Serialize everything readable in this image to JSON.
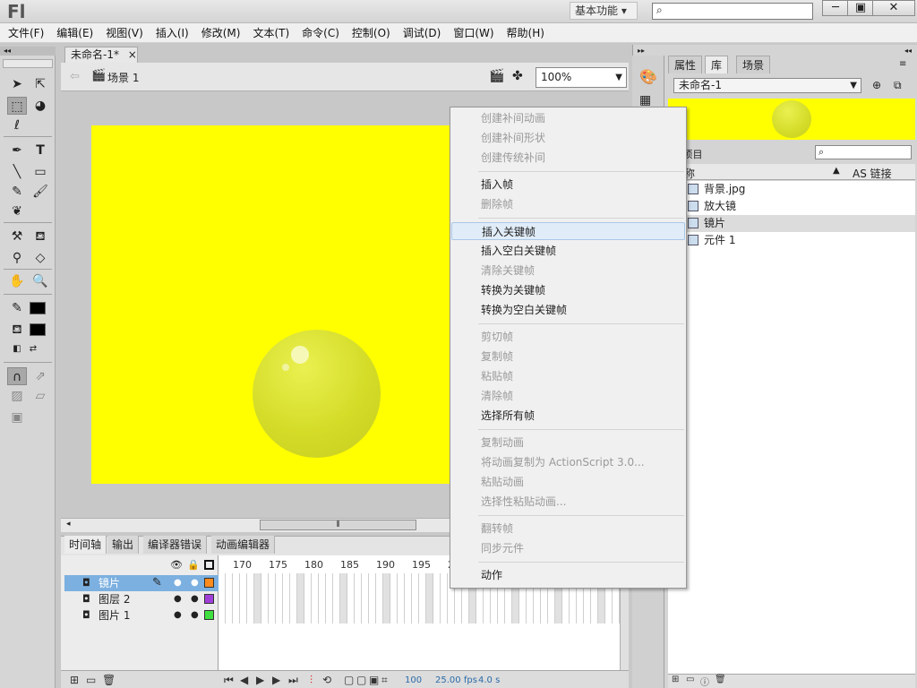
{
  "app": {
    "logo": "Fl",
    "workspace": "基本功能",
    "window_controls": {
      "minimize": "─",
      "maximize": "▣",
      "close": "✕"
    }
  },
  "menu": [
    "文件(F)",
    "编辑(E)",
    "视图(V)",
    "插入(I)",
    "修改(M)",
    "文本(T)",
    "命令(C)",
    "控制(O)",
    "调试(D)",
    "窗口(W)",
    "帮助(H)"
  ],
  "document": {
    "tab_title": "未命名-1*",
    "tab_close": "×",
    "scene": "场景 1",
    "zoom": "100%"
  },
  "stage": {
    "background_color": "#ffff00"
  },
  "timeline": {
    "tabs": [
      "时间轴",
      "输出",
      "编译器错误",
      "动画编辑器"
    ],
    "ruler": [
      "170",
      "175",
      "180",
      "185",
      "190",
      "195",
      "2"
    ],
    "layers": [
      {
        "name": "镜片",
        "color": "#ff8a1e",
        "selected": true
      },
      {
        "name": "图层 2",
        "color": "#a040d8",
        "selected": false
      },
      {
        "name": "图片 1",
        "color": "#40e040",
        "selected": false
      }
    ],
    "status": {
      "frame": "100",
      "fps": "25.00",
      "fps_unit": "fps",
      "time": "4.0",
      "time_unit": "s"
    }
  },
  "library": {
    "tabs": [
      "属性",
      "库",
      "场景"
    ],
    "document": "未命名-1",
    "count_label": "4 项目",
    "column_name": "名称",
    "column_linkage": "AS 链接",
    "items": [
      {
        "name": "背景.jpg",
        "icon": "bitmap-icon"
      },
      {
        "name": "放大镜",
        "icon": "movieclip-icon"
      },
      {
        "name": "镜片",
        "icon": "movieclip-icon"
      },
      {
        "name": "元件 1",
        "icon": "graphic-icon"
      }
    ],
    "selected_index": 2
  },
  "context_menu": {
    "groups": [
      [
        {
          "label": "创建补间动画",
          "disabled": true
        },
        {
          "label": "创建补间形状",
          "disabled": true
        },
        {
          "label": "创建传统补间",
          "disabled": true
        }
      ],
      [
        {
          "label": "插入帧",
          "disabled": false
        },
        {
          "label": "删除帧",
          "disabled": true
        }
      ],
      [
        {
          "label": "插入关键帧",
          "disabled": false,
          "highlighted": true
        },
        {
          "label": "插入空白关键帧",
          "disabled": false
        },
        {
          "label": "清除关键帧",
          "disabled": true
        },
        {
          "label": "转换为关键帧",
          "disabled": false
        },
        {
          "label": "转换为空白关键帧",
          "disabled": false
        }
      ],
      [
        {
          "label": "剪切帧",
          "disabled": true
        },
        {
          "label": "复制帧",
          "disabled": true
        },
        {
          "label": "粘贴帧",
          "disabled": true
        },
        {
          "label": "清除帧",
          "disabled": true
        },
        {
          "label": "选择所有帧",
          "disabled": false
        }
      ],
      [
        {
          "label": "复制动画",
          "disabled": true
        },
        {
          "label": "将动画复制为 ActionScript 3.0...",
          "disabled": true
        },
        {
          "label": "粘贴动画",
          "disabled": true
        },
        {
          "label": "选择性粘贴动画...",
          "disabled": true
        }
      ],
      [
        {
          "label": "翻转帧",
          "disabled": true
        },
        {
          "label": "同步元件",
          "disabled": true
        }
      ],
      [
        {
          "label": "动作",
          "disabled": false
        }
      ]
    ]
  }
}
